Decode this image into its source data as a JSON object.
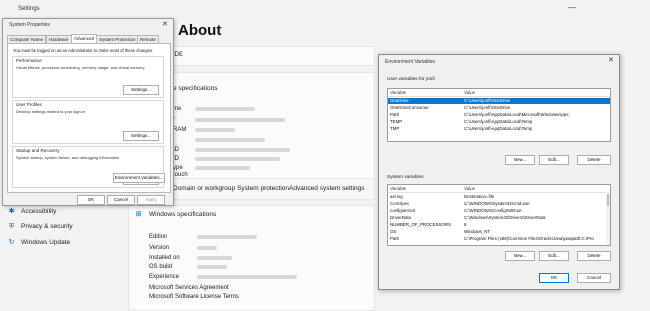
{
  "settings": {
    "app_title": "Settings",
    "minimize_glyph": "—",
    "page_title": "About",
    "device_label_partial": "IDE",
    "specs_heading_partial": "e specifications",
    "spec_rows": [
      "me",
      "r",
      "RAM",
      "",
      "ID",
      "ID",
      "ype",
      "touch"
    ],
    "related_links": [
      "Domain or workgroup",
      "System protection",
      "Advanced system settings"
    ],
    "nav_items": [
      {
        "label": "Accessibility",
        "icon": "accessibility-icon"
      },
      {
        "label": "Privacy & security",
        "icon": "shield-icon"
      },
      {
        "label": "Windows Update",
        "icon": "windows-update-icon"
      }
    ],
    "windows_specs": {
      "heading": "Windows specifications",
      "rows": [
        "Edition",
        "Version",
        "Installed on",
        "OS build",
        "Experience"
      ],
      "links": [
        "Microsoft Services Agreement",
        "Microsoft Software License Terms"
      ]
    }
  },
  "system_properties": {
    "title": "System Properties",
    "close_glyph": "✕",
    "tabs": [
      "Computer Name",
      "Hardware",
      "Advanced",
      "System Protection",
      "Remote"
    ],
    "active_tab": "Advanced",
    "admin_note": "You must be logged on as an Administrator to make most of these changes.",
    "groups": [
      {
        "title": "Performance",
        "desc": "Visual effects, processor scheduling, memory usage, and virtual memory",
        "button": "Settings..."
      },
      {
        "title": "User Profiles",
        "desc": "Desktop settings related to your sign-in",
        "button": "Settings..."
      },
      {
        "title": "Startup and Recovery",
        "desc": "System startup, system failure, and debugging information",
        "button": "Settings..."
      }
    ],
    "env_button": "Environment Variables...",
    "ok": "OK",
    "cancel": "Cancel",
    "apply": "Apply"
  },
  "environment_variables": {
    "title": "Environment Variables",
    "close_glyph": "✕",
    "user_section_label": "User variables for jonfi",
    "system_section_label": "System variables",
    "col_variable": "Variable",
    "col_value": "Value",
    "user_vars": [
      {
        "name": "OneDrive",
        "value": "C:\\Users\\jonfi\\OneDrive",
        "selected": true
      },
      {
        "name": "OneDriveConsumer",
        "value": "C:\\Users\\jonfi\\OneDrive",
        "selected": false
      },
      {
        "name": "Path",
        "value": "C:\\Users\\jonfi\\AppData\\Local\\Microsoft\\WindowsApps;",
        "selected": false
      },
      {
        "name": "TEMP",
        "value": "C:\\Users\\jonfi\\AppData\\Local\\Temp",
        "selected": false
      },
      {
        "name": "TMP",
        "value": "C:\\Users\\jonfi\\AppData\\Local\\Temp",
        "selected": false
      }
    ],
    "system_vars": [
      {
        "name": "asl.log",
        "value": "Destination=file"
      },
      {
        "name": "ComSpec",
        "value": "C:\\WINDOWS\\system32\\cmd.exe"
      },
      {
        "name": "configsetroot",
        "value": "C:\\WINDOWS\\ConfigSetRoot"
      },
      {
        "name": "DriverData",
        "value": "C:\\Windows\\System32\\Drivers\\DriverData"
      },
      {
        "name": "NUMBER_OF_PROCESSORS",
        "value": "8"
      },
      {
        "name": "OS",
        "value": "Windows_NT"
      },
      {
        "name": "Path",
        "value": "C:\\Program Files (x86)\\Common Files\\Oracle\\Java\\javapath;C:\\Pro"
      }
    ],
    "buttons": {
      "new": "New...",
      "edit": "Edit...",
      "delete": "Delete",
      "ok": "OK",
      "cancel": "Cancel"
    }
  }
}
